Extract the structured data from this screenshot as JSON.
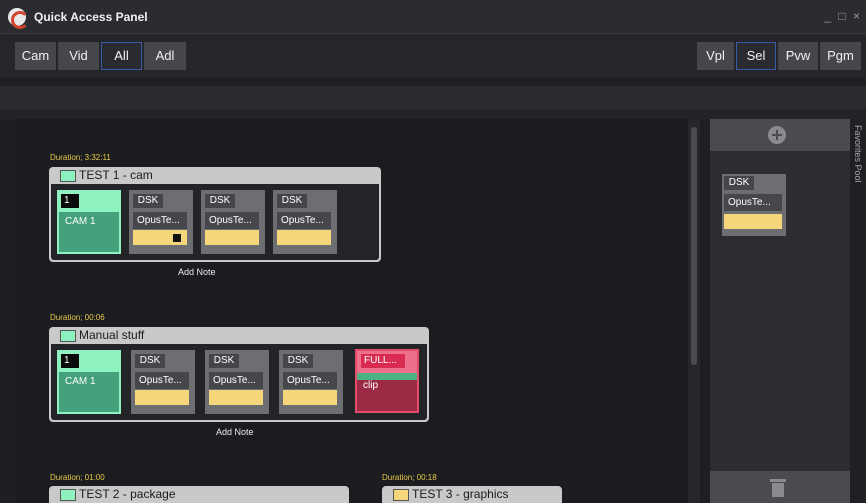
{
  "window": {
    "title": "Quick Access Panel",
    "controls": [
      "_",
      "□",
      "×"
    ]
  },
  "toolbar": {
    "left": [
      "Cam",
      "Vid",
      "All",
      "Adl"
    ],
    "right": [
      "Vpl",
      "Sel",
      "Pvw",
      "Pgm"
    ],
    "active_left": "All",
    "active_right": "Sel"
  },
  "groups": [
    {
      "duration": "Duration; 3:32:11",
      "title": "TEST 1 - cam",
      "swatch": "#8ef2c0",
      "cam_num": "1",
      "cam_label": "CAM 1",
      "dsk": [
        {
          "label": "DSK",
          "text": "OpusTe..."
        },
        {
          "label": "DSK",
          "text": "OpusTe..."
        },
        {
          "label": "DSK",
          "text": "OpusTe..."
        }
      ],
      "add_note": "Add Note"
    },
    {
      "duration": "Duration; 00:06",
      "title": "Manual stuff",
      "swatch": "#8ef2c0",
      "cam_num": "1",
      "cam_label": "CAM 1",
      "dsk": [
        {
          "label": "DSK",
          "text": "OpusTe..."
        },
        {
          "label": "DSK",
          "text": "OpusTe..."
        },
        {
          "label": "DSK",
          "text": "OpusTe..."
        }
      ],
      "full": {
        "title": "FULL...",
        "text": "clip"
      },
      "add_note": "Add Note"
    },
    {
      "duration": "Duration; 01:00",
      "title": "TEST 2 - package",
      "swatch": "#8ef2c0"
    },
    {
      "duration": "Duration; 00:18",
      "title": "TEST 3 - graphics",
      "swatch": "#f6d67a"
    }
  ],
  "favorites": {
    "tab_label": "Favorites Pool",
    "item": {
      "label": "DSK",
      "text": "OpusTe..."
    }
  },
  "colors": {
    "accent": "#3b5aa8",
    "cam": "#8ef2c0",
    "dsk_bar": "#f6d67a",
    "full": "#d72b52"
  }
}
